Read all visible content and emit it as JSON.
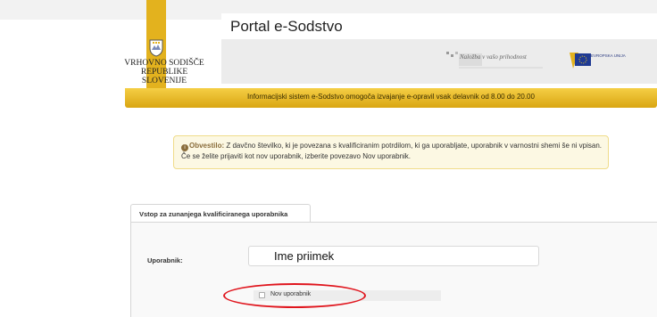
{
  "header": {
    "portal_title": "Portal e-Sodstvo",
    "court_name_line1": "VRHOVNO SODIŠČE",
    "court_name_line2": "REPUBLIKE SLOVENIJE",
    "info_bar_text": "Informacijski sistem e-Sodstvo omogoča izvajanje e-opravil vsak delavnik od 8.00 do 20.00",
    "logo1_text": "Naložba v vašo prihodnost",
    "logo2_text": "EVROPSKA UNIJA",
    "brand_gold": "#e3b21e",
    "icons": [
      "coat-of-arms-icon",
      "eu-flag-icon"
    ]
  },
  "notice": {
    "label": "Obvestilo:",
    "text": " Z davčno številko, ki je povezana s kvalificiranim potrdilom, ki ga uporabljate, uporabnik v varnostni shemi še ni vpisan. Če se želite prijaviti kot nov uporabnik, izberite povezavo Nov uporabnik.",
    "icon": "info-icon"
  },
  "login": {
    "tab_label": "Vstop za zunanjega kvalificiranega uporabnika",
    "user_label": "Uporabnik:",
    "user_value": "Ime priimek",
    "new_user_label": "Nov uporabnik",
    "highlight_color": "#e0161e"
  }
}
